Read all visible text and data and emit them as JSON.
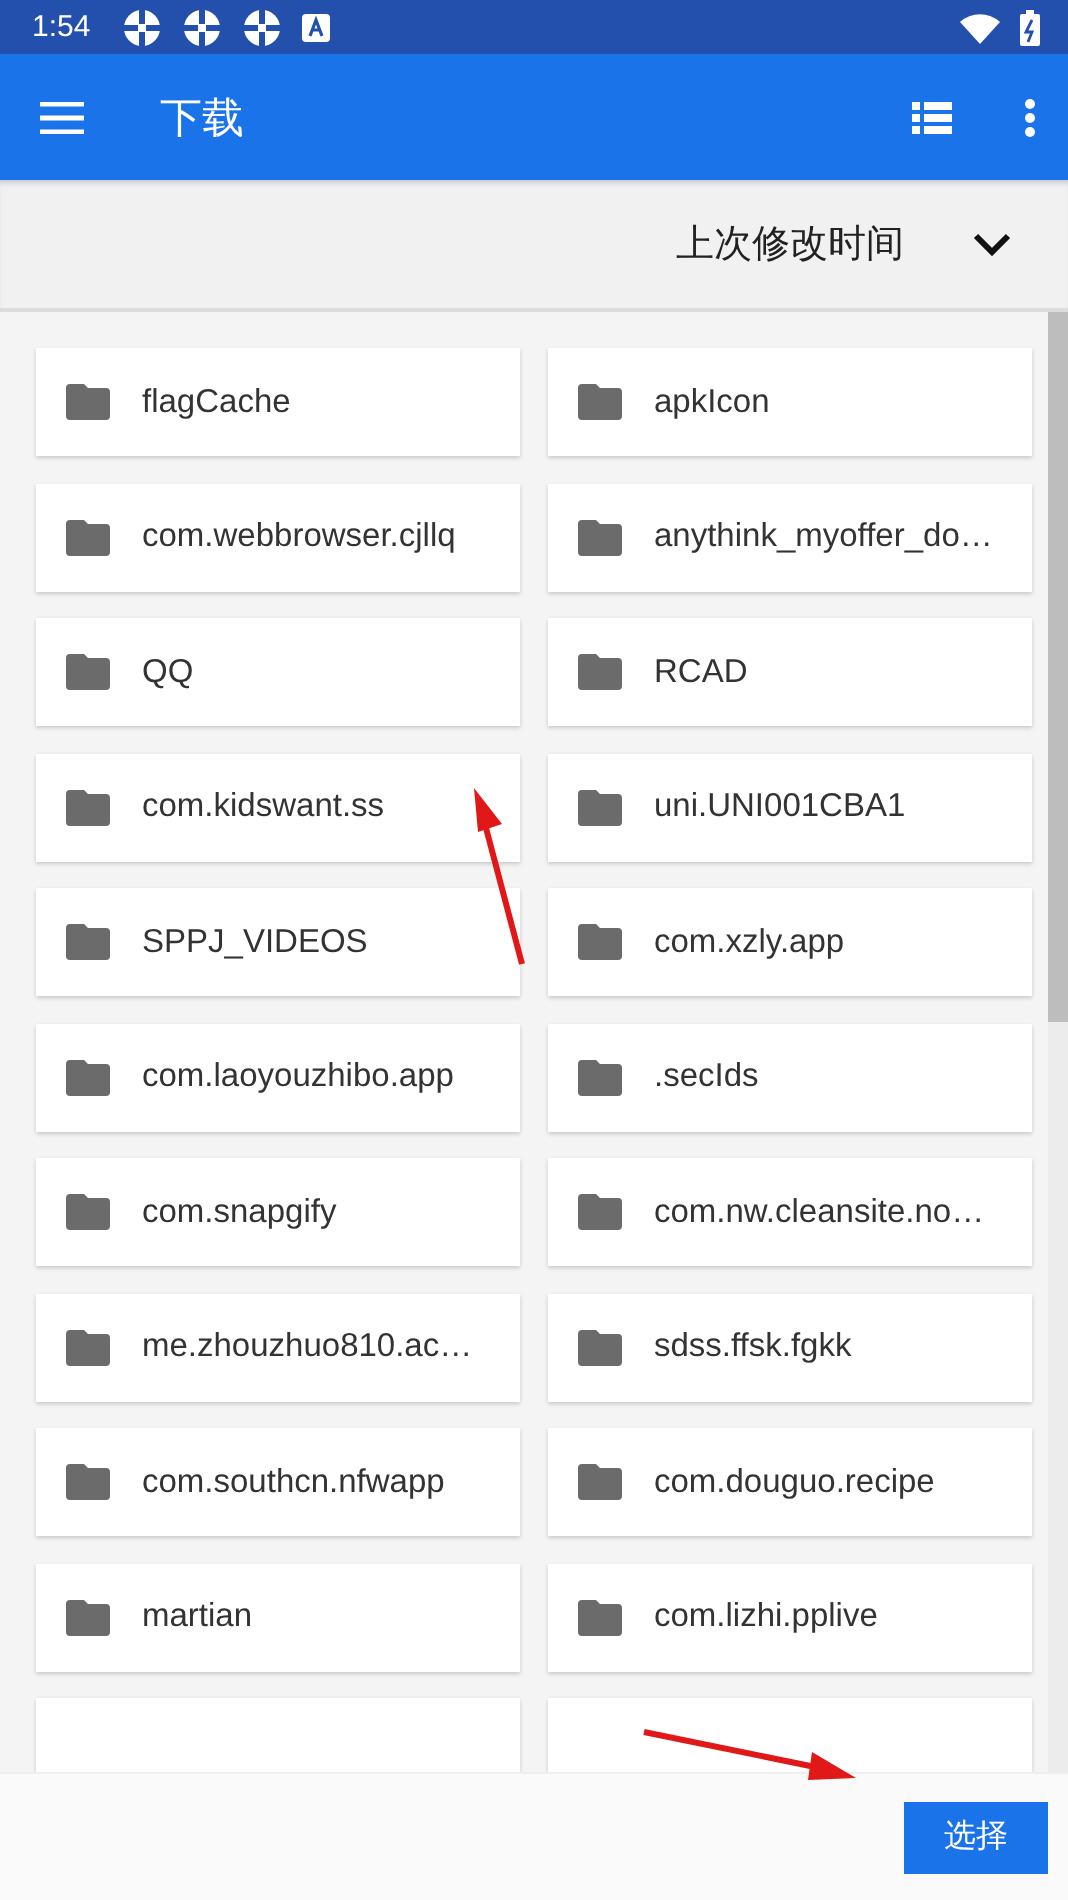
{
  "status_bar": {
    "time": "1:54"
  },
  "app_bar": {
    "title": "下载"
  },
  "sort_bar": {
    "label": "上次修改时间"
  },
  "folders": [
    {
      "name": "flagCache"
    },
    {
      "name": "apkIcon"
    },
    {
      "name": "com.webbrowser.cjllq"
    },
    {
      "name": "anythink_myoffer_do…"
    },
    {
      "name": "QQ"
    },
    {
      "name": "RCAD"
    },
    {
      "name": "com.kidswant.ss"
    },
    {
      "name": "uni.UNI001CBA1"
    },
    {
      "name": "SPPJ_VIDEOS"
    },
    {
      "name": "com.xzly.app"
    },
    {
      "name": "com.laoyouzhibo.app"
    },
    {
      "name": ".secIds"
    },
    {
      "name": "com.snapgify"
    },
    {
      "name": "com.nw.cleansite.no…"
    },
    {
      "name": "me.zhouzhuo810.ac…"
    },
    {
      "name": "sdss.ffsk.fgkk"
    },
    {
      "name": "com.southcn.nfwapp"
    },
    {
      "name": "com.douguo.recipe"
    },
    {
      "name": "martian"
    },
    {
      "name": "com.lizhi.pplive"
    }
  ],
  "bottom_bar": {
    "button": "选择"
  }
}
